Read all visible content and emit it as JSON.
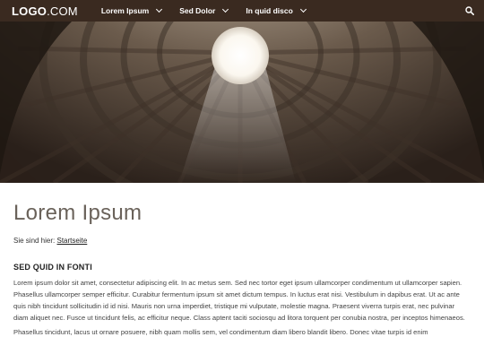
{
  "header": {
    "logo_main": "LOGO",
    "logo_suffix": ".COM",
    "nav": [
      {
        "label": "Lorem Ipsum"
      },
      {
        "label": "Sed Dolor"
      },
      {
        "label": "In quid disco"
      }
    ]
  },
  "page": {
    "title": "Lorem Ipsum",
    "breadcrumb_prefix": "Sie sind hier:",
    "breadcrumb_link": "Startseite",
    "section_heading": "SED QUID IN FONTI",
    "paragraphs": [
      "Lorem ipsum dolor sit amet, consectetur adipiscing elit. In ac metus sem. Sed nec tortor eget ipsum ullamcorper condimentum ut ullamcorper sapien. Phasellus ullamcorper semper efficitur. Curabitur fermentum ipsum sit amet dictum tempus. In luctus erat nisi. Vestibulum in dapibus erat. Ut ac ante quis nibh tincidunt sollicitudin id id nisi. Mauris non urna imperdiet, tristique mi vulputate, molestie magna. Praesent viverra turpis erat, nec pulvinar diam aliquet nec. Fusce ut tincidunt felis, ac efficitur neque. Class aptent taciti sociosqu ad litora torquent per conubia nostra, per inceptos himenaeos.",
      "Phasellus tincidunt, lacus ut ornare posuere, nibh quam mollis sem, vel condimentum diam libero blandit libero. Donec vitae turpis id enim"
    ]
  },
  "colors": {
    "header_bg": "#3a2a20",
    "title_color": "#6a625a"
  }
}
